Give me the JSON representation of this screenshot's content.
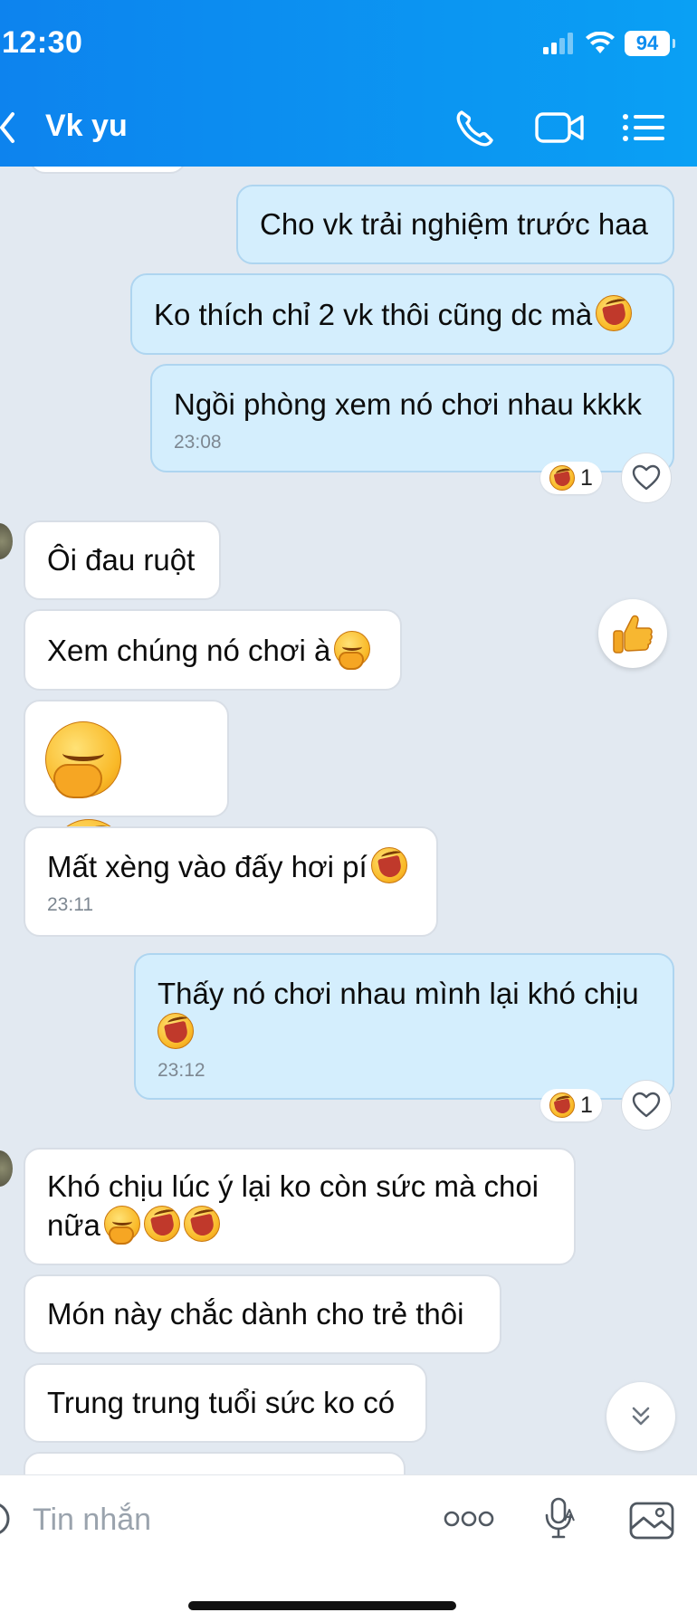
{
  "status_bar": {
    "time": "12:30",
    "battery": "94"
  },
  "header": {
    "title": "Vk yu"
  },
  "messages": [
    {
      "side": "sent",
      "text": "Cho vk trải nghiệm trước haa"
    },
    {
      "side": "sent",
      "text": "Ko thích chỉ 2 vk thôi cũng dc mà"
    },
    {
      "side": "sent",
      "text": "Ngồi phòng xem nó chơi nhau kkkk",
      "time": "23:08",
      "reaction_count": "1"
    },
    {
      "side": "received",
      "text": "Ôi đau ruột"
    },
    {
      "side": "received",
      "text": "Xem chúng nó chơi à"
    },
    {
      "side": "received",
      "text": ""
    },
    {
      "side": "received",
      "text": "Mất xèng vào đấy hơi pí",
      "time": "23:11"
    },
    {
      "side": "sent",
      "text": "Thấy nó chơi nhau mình lại khó chịu",
      "time": "23:12",
      "reaction_count": "1"
    },
    {
      "side": "received",
      "text": "Khó chịu lúc ý lại ko còn sức mà choi",
      "text_line2": "nữa"
    },
    {
      "side": "received",
      "text": "Món này chắc dành cho trẻ thôi"
    },
    {
      "side": "received",
      "text": "Trung trung tuổi sức ko có"
    }
  ],
  "input": {
    "placeholder": "Tin nhắn"
  },
  "colors": {
    "header": "#0d83ee",
    "sent_bubble": "#d4eefd",
    "received_bubble": "#ffffff",
    "chat_background": "#e2e9f1"
  }
}
